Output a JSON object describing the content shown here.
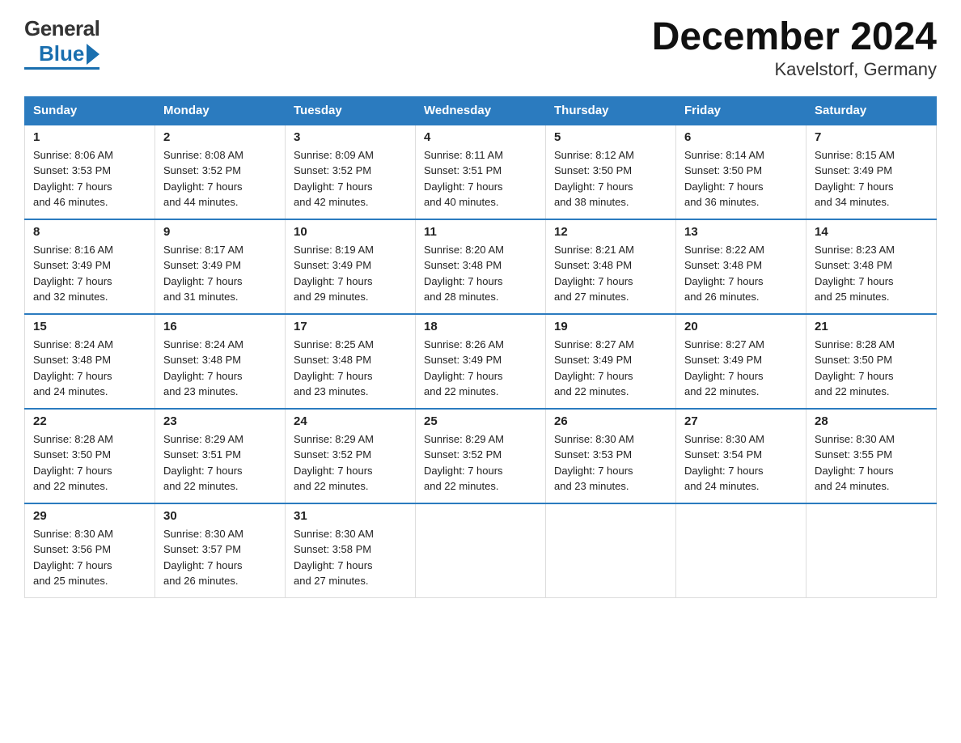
{
  "header": {
    "logo_general": "General",
    "logo_blue": "Blue",
    "title": "December 2024",
    "subtitle": "Kavelstorf, Germany"
  },
  "days_of_week": [
    "Sunday",
    "Monday",
    "Tuesday",
    "Wednesday",
    "Thursday",
    "Friday",
    "Saturday"
  ],
  "weeks": [
    [
      {
        "day": "1",
        "sunrise": "8:06 AM",
        "sunset": "3:53 PM",
        "daylight": "7 hours and 46 minutes."
      },
      {
        "day": "2",
        "sunrise": "8:08 AM",
        "sunset": "3:52 PM",
        "daylight": "7 hours and 44 minutes."
      },
      {
        "day": "3",
        "sunrise": "8:09 AM",
        "sunset": "3:52 PM",
        "daylight": "7 hours and 42 minutes."
      },
      {
        "day": "4",
        "sunrise": "8:11 AM",
        "sunset": "3:51 PM",
        "daylight": "7 hours and 40 minutes."
      },
      {
        "day": "5",
        "sunrise": "8:12 AM",
        "sunset": "3:50 PM",
        "daylight": "7 hours and 38 minutes."
      },
      {
        "day": "6",
        "sunrise": "8:14 AM",
        "sunset": "3:50 PM",
        "daylight": "7 hours and 36 minutes."
      },
      {
        "day": "7",
        "sunrise": "8:15 AM",
        "sunset": "3:49 PM",
        "daylight": "7 hours and 34 minutes."
      }
    ],
    [
      {
        "day": "8",
        "sunrise": "8:16 AM",
        "sunset": "3:49 PM",
        "daylight": "7 hours and 32 minutes."
      },
      {
        "day": "9",
        "sunrise": "8:17 AM",
        "sunset": "3:49 PM",
        "daylight": "7 hours and 31 minutes."
      },
      {
        "day": "10",
        "sunrise": "8:19 AM",
        "sunset": "3:49 PM",
        "daylight": "7 hours and 29 minutes."
      },
      {
        "day": "11",
        "sunrise": "8:20 AM",
        "sunset": "3:48 PM",
        "daylight": "7 hours and 28 minutes."
      },
      {
        "day": "12",
        "sunrise": "8:21 AM",
        "sunset": "3:48 PM",
        "daylight": "7 hours and 27 minutes."
      },
      {
        "day": "13",
        "sunrise": "8:22 AM",
        "sunset": "3:48 PM",
        "daylight": "7 hours and 26 minutes."
      },
      {
        "day": "14",
        "sunrise": "8:23 AM",
        "sunset": "3:48 PM",
        "daylight": "7 hours and 25 minutes."
      }
    ],
    [
      {
        "day": "15",
        "sunrise": "8:24 AM",
        "sunset": "3:48 PM",
        "daylight": "7 hours and 24 minutes."
      },
      {
        "day": "16",
        "sunrise": "8:24 AM",
        "sunset": "3:48 PM",
        "daylight": "7 hours and 23 minutes."
      },
      {
        "day": "17",
        "sunrise": "8:25 AM",
        "sunset": "3:48 PM",
        "daylight": "7 hours and 23 minutes."
      },
      {
        "day": "18",
        "sunrise": "8:26 AM",
        "sunset": "3:49 PM",
        "daylight": "7 hours and 22 minutes."
      },
      {
        "day": "19",
        "sunrise": "8:27 AM",
        "sunset": "3:49 PM",
        "daylight": "7 hours and 22 minutes."
      },
      {
        "day": "20",
        "sunrise": "8:27 AM",
        "sunset": "3:49 PM",
        "daylight": "7 hours and 22 minutes."
      },
      {
        "day": "21",
        "sunrise": "8:28 AM",
        "sunset": "3:50 PM",
        "daylight": "7 hours and 22 minutes."
      }
    ],
    [
      {
        "day": "22",
        "sunrise": "8:28 AM",
        "sunset": "3:50 PM",
        "daylight": "7 hours and 22 minutes."
      },
      {
        "day": "23",
        "sunrise": "8:29 AM",
        "sunset": "3:51 PM",
        "daylight": "7 hours and 22 minutes."
      },
      {
        "day": "24",
        "sunrise": "8:29 AM",
        "sunset": "3:52 PM",
        "daylight": "7 hours and 22 minutes."
      },
      {
        "day": "25",
        "sunrise": "8:29 AM",
        "sunset": "3:52 PM",
        "daylight": "7 hours and 22 minutes."
      },
      {
        "day": "26",
        "sunrise": "8:30 AM",
        "sunset": "3:53 PM",
        "daylight": "7 hours and 23 minutes."
      },
      {
        "day": "27",
        "sunrise": "8:30 AM",
        "sunset": "3:54 PM",
        "daylight": "7 hours and 24 minutes."
      },
      {
        "day": "28",
        "sunrise": "8:30 AM",
        "sunset": "3:55 PM",
        "daylight": "7 hours and 24 minutes."
      }
    ],
    [
      {
        "day": "29",
        "sunrise": "8:30 AM",
        "sunset": "3:56 PM",
        "daylight": "7 hours and 25 minutes."
      },
      {
        "day": "30",
        "sunrise": "8:30 AM",
        "sunset": "3:57 PM",
        "daylight": "7 hours and 26 minutes."
      },
      {
        "day": "31",
        "sunrise": "8:30 AM",
        "sunset": "3:58 PM",
        "daylight": "7 hours and 27 minutes."
      },
      null,
      null,
      null,
      null
    ]
  ],
  "labels": {
    "sunrise": "Sunrise:",
    "sunset": "Sunset:",
    "daylight": "Daylight:"
  }
}
